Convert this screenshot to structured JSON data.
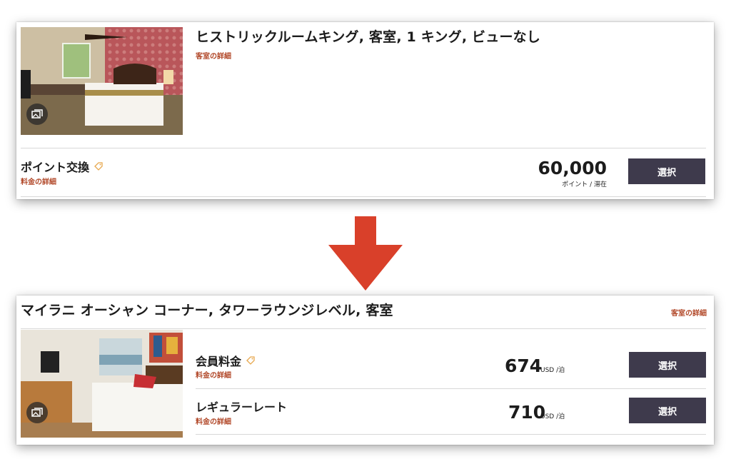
{
  "card_top": {
    "room_title": "ヒストリックルームキング, 客室, 1 キング, ビューなし",
    "room_details_link": "客室の詳細",
    "rate": {
      "name": "ポイント交換",
      "details_link": "料金の詳細",
      "price": "60,000",
      "unit": "ポイント / 滞在",
      "select_label": "選択"
    }
  },
  "card_bottom": {
    "room_title": "マイラニ オーシャン コーナー, タワーラウンジレベル, 客室",
    "room_details_link": "客室の詳細",
    "rates": [
      {
        "name": "会員料金",
        "details_link": "料金の詳細",
        "price": "674",
        "unit": "USD /泊",
        "select_label": "選択"
      },
      {
        "name": "レギュラーレート",
        "details_link": "料金の詳細",
        "price": "710",
        "unit": "USD /泊",
        "select_label": "選択"
      }
    ]
  },
  "colors": {
    "accent_link": "#b2492a",
    "button": "#3e3a4c",
    "arrow": "#d9402a"
  },
  "icons": [
    "gallery-icon",
    "tag-icon",
    "down-arrow-icon"
  ]
}
